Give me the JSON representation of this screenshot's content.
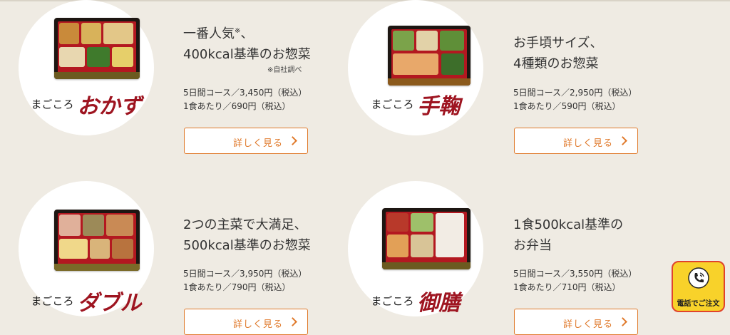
{
  "products": [
    {
      "logo_prefix": "まごころ",
      "logo_name": "おかず",
      "headline_line1": "一番人気",
      "headline_mark": "※",
      "headline_suffix": "、",
      "headline_line2": "400kcal基準のお惣菜",
      "note": "※自社調べ",
      "price_course": "5日間コース／3,450円（税込）",
      "price_meal": "1食あたり／690円（税込）",
      "button_label": "詳しく見る"
    },
    {
      "logo_prefix": "まごころ",
      "logo_name": "手鞠",
      "headline_line1": "お手頃サイズ、",
      "headline_line2": "4種類のお惣菜",
      "price_course": "5日間コース／2,950円（税込）",
      "price_meal": "1食あたり／590円（税込）",
      "button_label": "詳しく見る"
    },
    {
      "logo_prefix": "まごころ",
      "logo_name": "ダブル",
      "headline_line1": "2つの主菜で大満足、",
      "headline_line2": "500kcal基準のお惣菜",
      "price_course": "5日間コース／3,950円（税込）",
      "price_meal": "1食あたり／790円（税込）",
      "button_label": "詳しく見る"
    },
    {
      "logo_prefix": "まごころ",
      "logo_name": "御膳",
      "headline_line1": "1食500kcal基準の",
      "headline_line2": "お弁当",
      "price_course": "5日間コース／3,550円（税込）",
      "price_meal": "1食あたり／710円（税込）",
      "button_label": "詳しく見る"
    }
  ],
  "phone_order": {
    "label": "電話でご注文",
    "icon": "phone-icon"
  },
  "colors": {
    "accent": "#e07a2c",
    "background": "#efebe3",
    "logo_red": "#9e1420"
  }
}
